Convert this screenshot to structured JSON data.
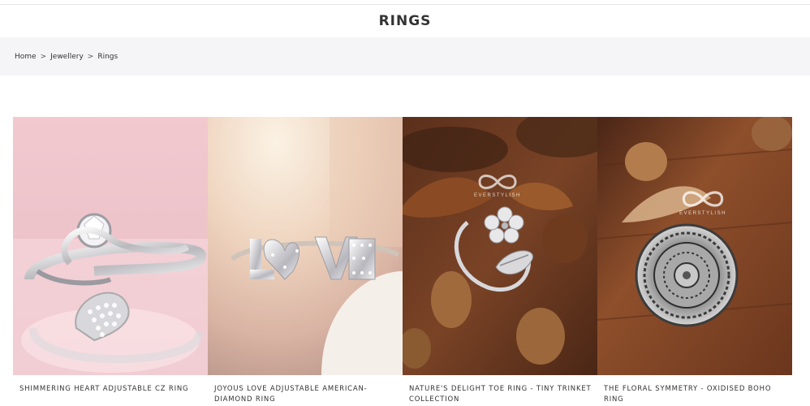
{
  "page": {
    "title": "RINGS"
  },
  "breadcrumb": [
    {
      "label": "Home"
    },
    {
      "label": "Jewellery"
    },
    {
      "label": "Rings"
    }
  ],
  "breadcrumb_separator": ">",
  "products": [
    {
      "name": "SHIMMERING HEART ADJUSTABLE CZ RING"
    },
    {
      "name": "JOYOUS LOVE ADJUSTABLE AMERICAN-DIAMOND RING"
    },
    {
      "name": "NATURE'S DELIGHT TOE RING - TINY TRINKET COLLECTION"
    },
    {
      "name": "THE FLORAL SYMMETRY - OXIDISED BOHO RING"
    }
  ],
  "brand_watermark": "EVERSTYLISH",
  "colors": {
    "breadcrumb_bg": "#f5f5f7",
    "text": "#333333"
  }
}
